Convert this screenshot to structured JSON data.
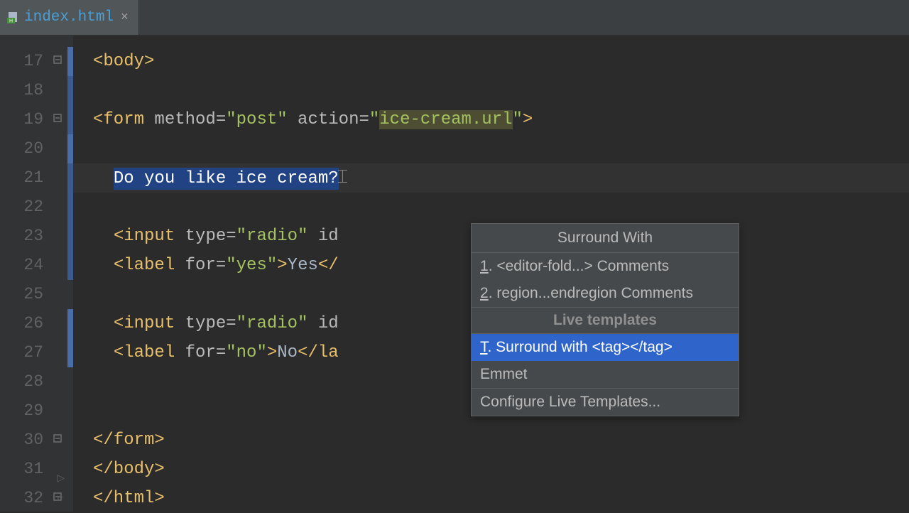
{
  "tab": {
    "filename": "index.html",
    "icon": "html-file-icon"
  },
  "gutter": {
    "start": 17,
    "end": 32
  },
  "code": {
    "l17": {
      "indent": "",
      "tag_open": "<body>"
    },
    "l19": {
      "indent": "",
      "tag_open": "<form",
      "attr1_name": " method=",
      "attr1_val": "\"post\"",
      "attr2_name": " action=",
      "attr2_q1": "\"",
      "attr2_val": "ice-cream.url",
      "attr2_q2": "\"",
      "tag_close": ">"
    },
    "l21": {
      "selected_text": "Do you like ice cream?"
    },
    "l23": {
      "tag_open": "<input",
      "attr1_name": " type=",
      "attr1_val": "\"radio\"",
      "attr2_name": " id"
    },
    "l24": {
      "tag_open": "<label",
      "attr1_name": " for=",
      "attr1_val": "\"yes\"",
      "tag_mid": ">",
      "content": "Yes",
      "tag_close_partial": "</"
    },
    "l26": {
      "tag_open": "<input",
      "attr1_name": " type=",
      "attr1_val": "\"radio\"",
      "attr2_name": " id"
    },
    "l27": {
      "tag_open": "<label",
      "attr1_name": " for=",
      "attr1_val": "\"no\"",
      "tag_mid": ">",
      "content": "No",
      "tag_close_partial": "</la"
    },
    "l30": {
      "tag_close": "</form>"
    },
    "l31": {
      "tag_close": "</body>"
    },
    "l32": {
      "tag_close": "</html>"
    }
  },
  "popup": {
    "title": "Surround With",
    "items_top": [
      {
        "mnemonic": "1",
        "rest": ". <editor-fold...> Comments"
      },
      {
        "mnemonic": "2",
        "rest": ". region...endregion Comments"
      }
    ],
    "section": "Live templates",
    "items_bottom": [
      {
        "mnemonic": "T",
        "rest": ". Surround with <tag></tag>",
        "selected": true
      },
      {
        "text": "Emmet"
      },
      {
        "text": "Configure Live Templates..."
      }
    ]
  }
}
